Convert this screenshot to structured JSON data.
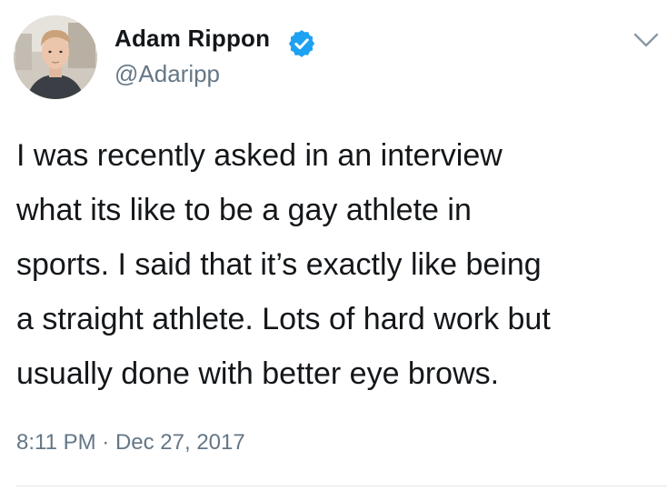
{
  "tweet": {
    "author": {
      "display_name": "Adam Rippon",
      "handle": "@Adaripp",
      "verified": true,
      "avatar_icon": "profile-photo",
      "verified_icon": "verified-badge-icon"
    },
    "menu_icon": "chevron-down-icon",
    "body_lines": [
      "I was recently asked in an interview",
      "what its like to be a gay athlete in",
      "sports. I said that it’s exactly like being",
      "a straight athlete. Lots of hard work but",
      "usually done with better eye brows."
    ],
    "time": "8:11 PM",
    "separator": "·",
    "date": "Dec 27, 2017"
  },
  "colors": {
    "text": "#14171a",
    "secondary": "#657786",
    "verified": "#1da1f2",
    "divider": "#e1e8ed"
  }
}
